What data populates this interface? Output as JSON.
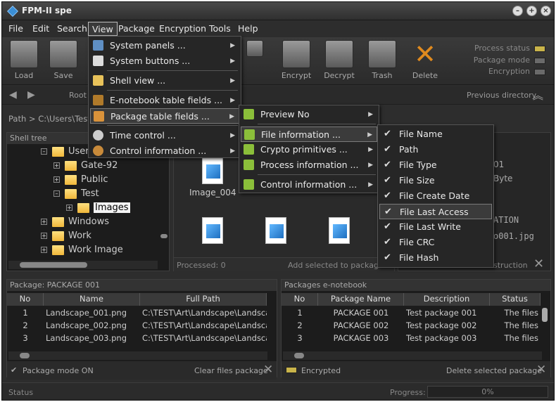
{
  "app": {
    "title": "FPM-II spe"
  },
  "menubar": [
    "File",
    "Edit",
    "Search",
    "View",
    "Package",
    "Encryption",
    "Tools",
    "Help"
  ],
  "toolbar": {
    "buttons": [
      "Load",
      "Save",
      "Encrypt",
      "Decrypt",
      "Trash",
      "Delete"
    ]
  },
  "status_indicators": [
    {
      "label": "Process status",
      "color": "#c9b44a"
    },
    {
      "label": "Package mode",
      "color": "#6a6a6a"
    },
    {
      "label": "Encryption",
      "color": "#6a6a6a"
    }
  ],
  "nav": {
    "root": "Root",
    "previous": "Previous directory"
  },
  "path": {
    "text": "Path >  C:\\Users\\Test\\"
  },
  "shell_tree": {
    "title": "Shell tree",
    "nodes": [
      "Users",
      "Gate-92",
      "Public",
      "Test",
      "Images",
      "Windows",
      "Work",
      "Work Image"
    ]
  },
  "preview": {
    "image_label": "Image_004",
    "processed": "Processed: 0",
    "add_selected": "Add selected to package"
  },
  "right_info": {
    "t1": "01",
    "t2": "Byte",
    "t3": "ATION",
    "t4": "o001.jpg",
    "destruction": "struction"
  },
  "package_panel": {
    "title": "Package: PACKAGE 001",
    "columns": [
      "No",
      "Name",
      "Full Path"
    ],
    "rows": [
      {
        "no": "1",
        "name": "Landscape_001.png",
        "path": "C:\\TEST\\Art\\Landscape\\Landscape_0"
      },
      {
        "no": "2",
        "name": "Landscape_002.png",
        "path": "C:\\TEST\\Art\\Landscape\\Landscape_0"
      },
      {
        "no": "3",
        "name": "Landscape_003.png",
        "path": "C:\\TEST\\Art\\Landscape\\Landscape_0"
      }
    ],
    "mode": "Package mode ON",
    "clear": "Clear files package"
  },
  "enotebook_panel": {
    "title": "Packages e-notebook",
    "columns": [
      "No",
      "Package Name",
      "Description",
      "Status"
    ],
    "rows": [
      {
        "no": "1",
        "name": "PACKAGE 001",
        "desc": "Test package 001",
        "status": "The files"
      },
      {
        "no": "2",
        "name": "PACKAGE 002",
        "desc": "Test package 002",
        "status": "The files"
      },
      {
        "no": "3",
        "name": "PACKAGE 003",
        "desc": "Test package 003",
        "status": "The files"
      }
    ],
    "encrypted": "Encrypted",
    "delete": "Delete selected  package"
  },
  "statusbar": {
    "status": "Status",
    "progress_label": "Progress:",
    "progress_value": "0%",
    "progress_fraction": 0
  },
  "view_menu": {
    "items": [
      "System panels ...",
      "System buttons ...",
      "Shell view ...",
      "E-notebook table fields ...",
      "Package table fields ...",
      "Time control ...",
      "Control information ..."
    ]
  },
  "package_fields_menu": {
    "items": [
      "Preview No",
      "File information ...",
      "Crypto primitives ...",
      "Process information ...",
      "Control information ..."
    ]
  },
  "file_info_menu": {
    "items": [
      "File Name",
      "Path",
      "File Type",
      "File Size",
      "File Create Date",
      "File Last Access",
      "File Last Write",
      "File CRC",
      "File Hash"
    ]
  }
}
